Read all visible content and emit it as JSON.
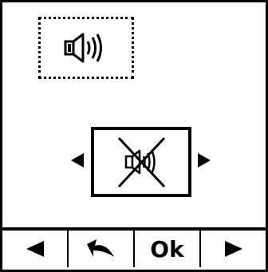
{
  "screen": {
    "icons": {
      "top": "speaker-sound-icon",
      "center": "speaker-muted-icon",
      "nav_left": "triangle-left-icon",
      "nav_right": "triangle-right-icon"
    }
  },
  "softkeys": {
    "left_icon": "left-arrow-icon",
    "back_icon": "curved-back-arrow-icon",
    "ok_label": "Ok",
    "right_icon": "right-arrow-icon"
  }
}
